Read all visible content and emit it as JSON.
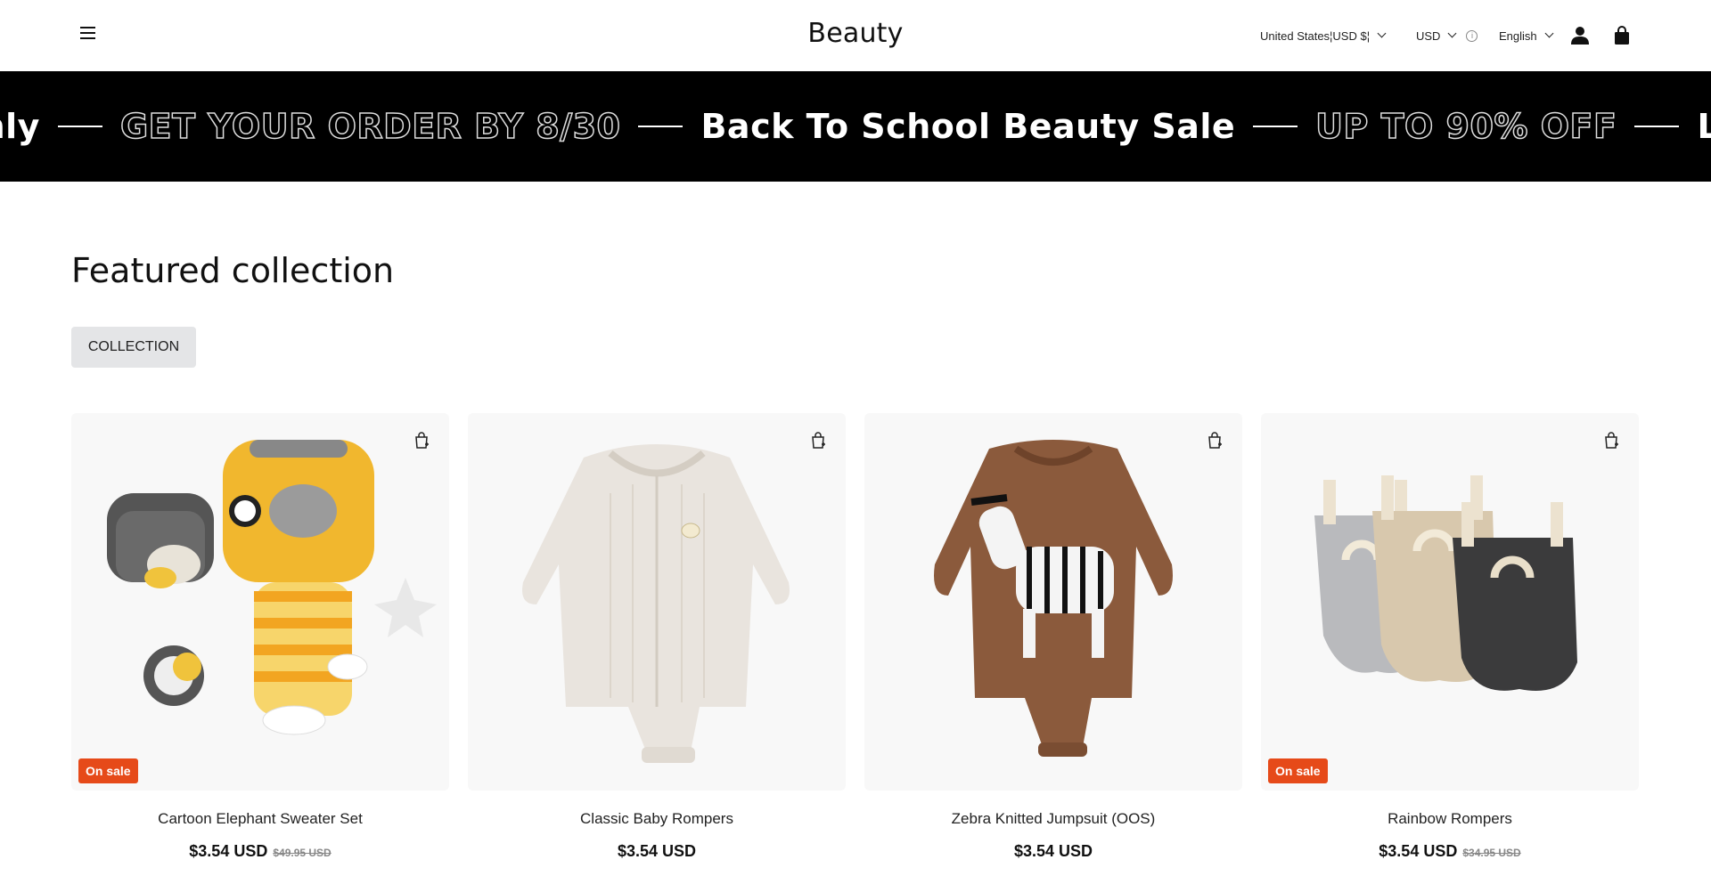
{
  "header": {
    "logo": "Beauty",
    "country": "United States¦USD $¦",
    "currency": "USD",
    "language": "English"
  },
  "marquee": {
    "items": [
      {
        "text": "only",
        "style": "solid"
      },
      {
        "text": "GET YOUR ORDER BY 8/30",
        "style": "outline"
      },
      {
        "text": "Back To School Beauty Sale",
        "style": "solid"
      },
      {
        "text": "UP TO 90% OFF",
        "style": "outline"
      },
      {
        "text": "Limited time o",
        "style": "solid"
      }
    ]
  },
  "featured": {
    "title": "Featured collection",
    "button": "COLLECTION"
  },
  "products": [
    {
      "title": "Cartoon Elephant Sweater Set",
      "price": "$3.54 USD",
      "compare": "$49.95 USD",
      "badge": "On sale"
    },
    {
      "title": "Classic Baby Rompers",
      "price": "$3.54 USD",
      "compare": "",
      "badge": ""
    },
    {
      "title": "Zebra Knitted Jumpsuit (OOS)",
      "price": "$3.54 USD",
      "compare": "",
      "badge": ""
    },
    {
      "title": "Rainbow Rompers",
      "price": "$3.54 USD",
      "compare": "$34.95 USD",
      "badge": "On sale"
    }
  ],
  "colors": {
    "sale_badge": "#e64a19",
    "marquee_bg": "#000000",
    "button_bg": "#e4e5e7"
  },
  "icons": [
    "hamburger-icon",
    "chevron-down-icon",
    "info-icon",
    "user-icon",
    "shopping-bag-icon",
    "add-to-cart-icon"
  ]
}
